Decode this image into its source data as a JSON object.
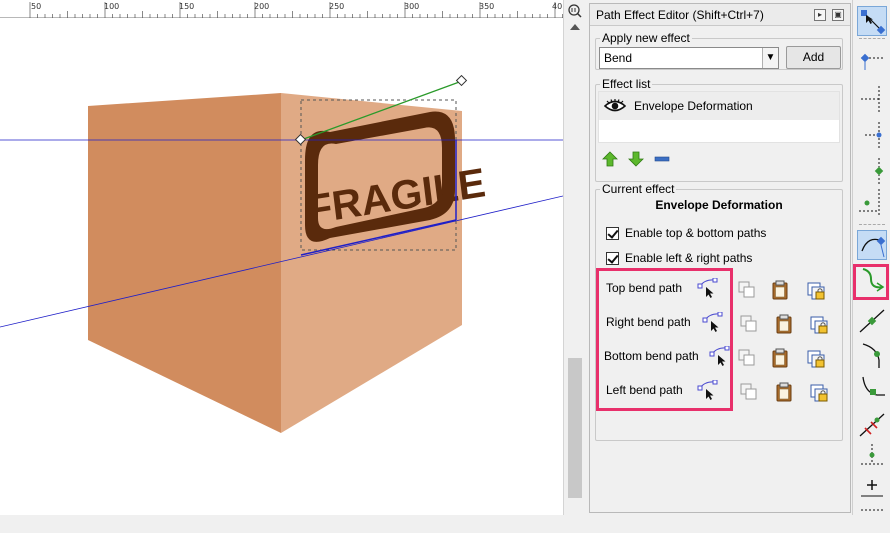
{
  "ruler": {
    "labels": [
      "50",
      "100",
      "150",
      "200",
      "250",
      "300",
      "350",
      "40"
    ]
  },
  "canvas": {
    "artwork_text": "FRAGILE"
  },
  "panel": {
    "title": "Path Effect Editor (Shift+Ctrl+7)",
    "apply_group": {
      "legend": "Apply new effect",
      "selected_effect": "Bend",
      "add_label": "Add"
    },
    "list_group": {
      "legend": "Effect list",
      "items": [
        {
          "name": "Envelope Deformation",
          "visible": true,
          "icon": "eye-icon"
        }
      ]
    },
    "current_group": {
      "legend": "Current effect",
      "effect_title": "Envelope Deformation",
      "checkboxes": [
        {
          "label": "Enable top & bottom paths",
          "checked": true
        },
        {
          "label": "Enable left & right paths",
          "checked": true
        }
      ],
      "bend_paths": [
        {
          "label": "Top bend path"
        },
        {
          "label": "Right bend path"
        },
        {
          "label": "Bottom bend path"
        },
        {
          "label": "Left bend path"
        }
      ]
    }
  },
  "colors": {
    "box_front": "#d18c5e",
    "box_side": "#e0aa85",
    "box_label_dark": "#5a2a0c",
    "highlight": "#e8306b",
    "guide_blue": "#1f1fc8",
    "handle_green": "#2a9a2a"
  },
  "toolbar": {
    "icons": [
      "node-select-icon",
      "node-add-icon",
      "node-insert-icon",
      "node-delete-icon",
      "node-join-icon",
      "node-break-icon",
      "segment-line-icon",
      "segment-curve-icon",
      "node-cusp-icon",
      "node-smooth-icon",
      "node-symmetric-icon",
      "node-auto-icon",
      "stroke-to-path-icon",
      "object-to-path-icon",
      "show-handles-icon"
    ]
  }
}
